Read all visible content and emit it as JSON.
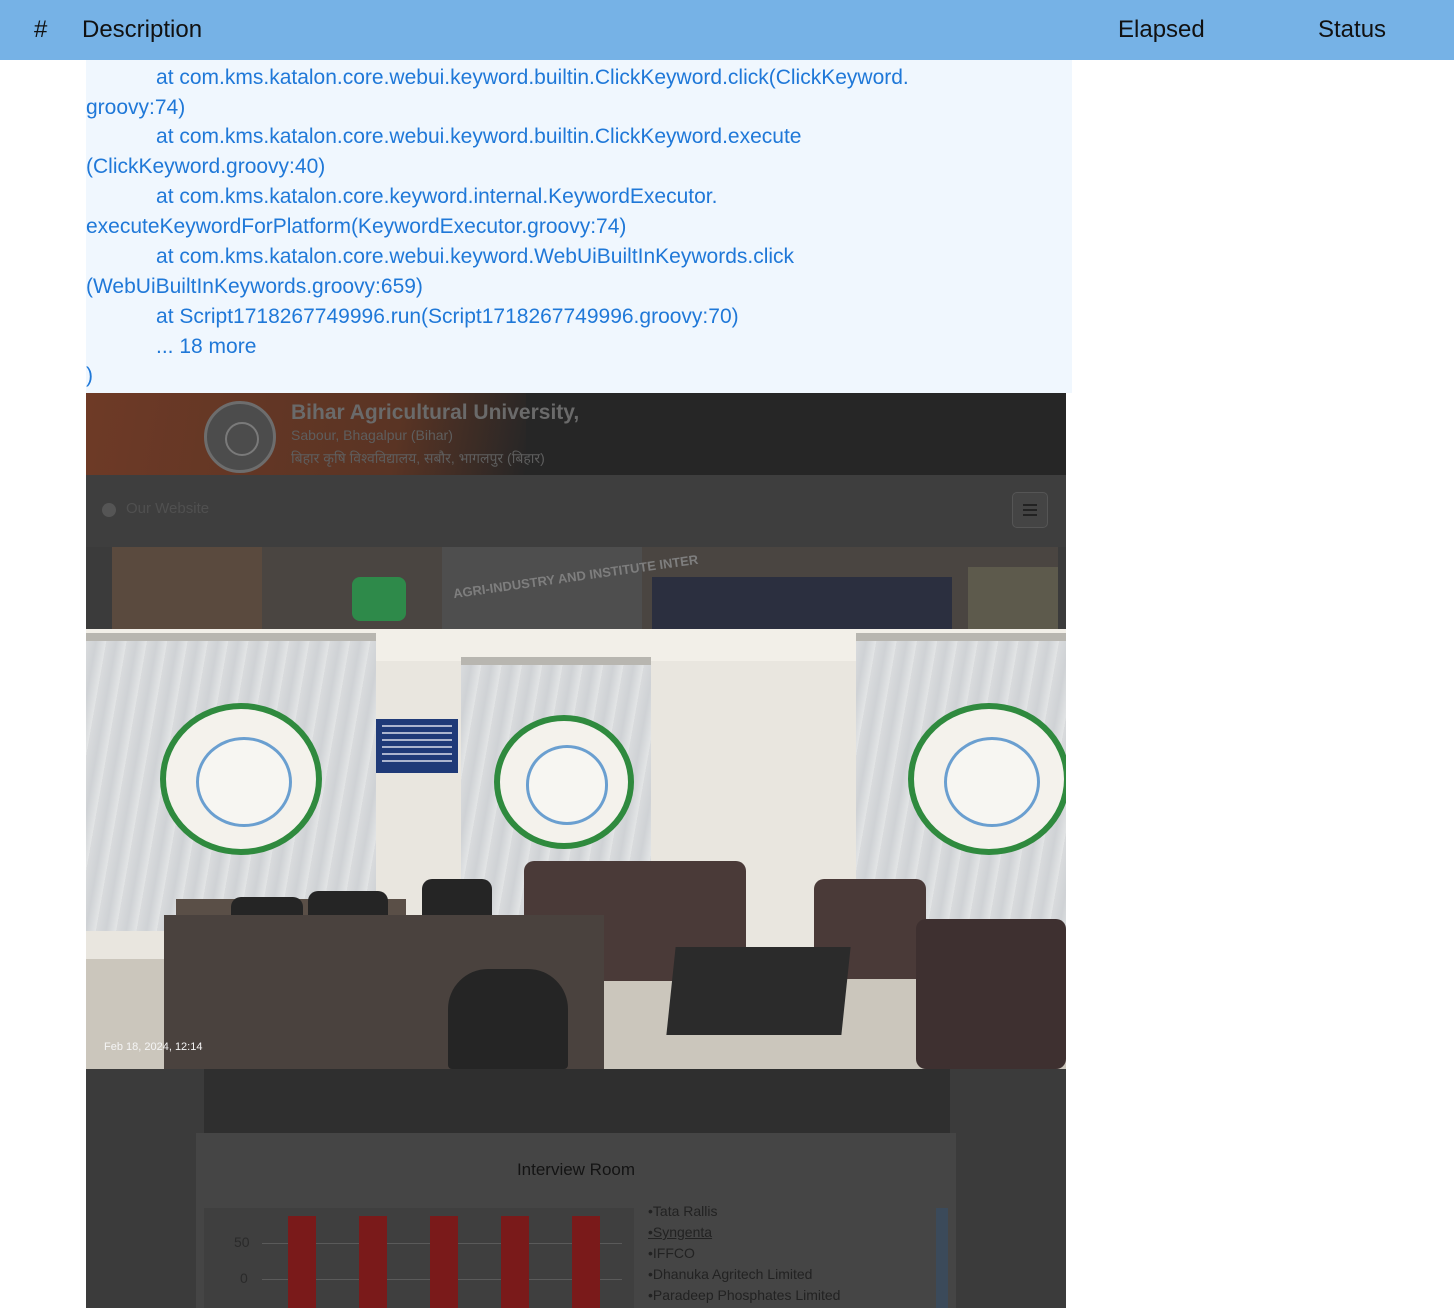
{
  "table_header": {
    "hash": "#",
    "description": "Description",
    "elapsed": "Elapsed",
    "status": "Status"
  },
  "log_lines": [
    "            at com.kms.katalon.core.webui.keyword.builtin.ClickKeyword.click(ClickKeyword.",
    "groovy:74)",
    "            at com.kms.katalon.core.webui.keyword.builtin.ClickKeyword.execute",
    "(ClickKeyword.groovy:40)",
    "            at com.kms.katalon.core.keyword.internal.KeywordExecutor.",
    "executeKeywordForPlatform(KeywordExecutor.groovy:74)",
    "            at com.kms.katalon.core.webui.keyword.WebUiBuiltInKeywords.click",
    "(WebUiBuiltInKeywords.groovy:659)",
    "            at Script1718267749996.run(Script1718267749996.groovy:70)",
    "            ... 18 more",
    ")"
  ],
  "screenshot": {
    "university_name": "Bihar Agricultural University,",
    "university_location": "Sabour, Bhagalpur (Bihar)",
    "university_hindi": "बिहार कृषि विश्वविद्यालय, सबौर, भागलपुर (बिहार)",
    "nav_text": "Our Website",
    "banner_text": "AGRI-INDUSTRY AND INSTITUTE INTER",
    "photo_timestamp": "Feb 18, 2024, 12:14",
    "room_title": "Interview Room",
    "companies": [
      "•Tata Rallis",
      "•Syngenta",
      "•IFFCO",
      "•Dhanuka Agritech Limited",
      "•Paradeep Phosphates Limited"
    ]
  },
  "chart_data": {
    "type": "bar",
    "categories": [
      "",
      "",
      "",
      "",
      ""
    ],
    "values": [
      88,
      88,
      88,
      88,
      88
    ],
    "ylim": [
      0,
      100
    ],
    "yticks": [
      "50",
      "0"
    ]
  }
}
